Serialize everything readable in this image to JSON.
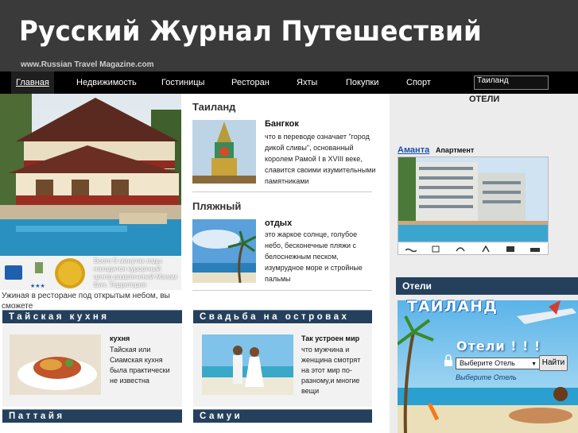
{
  "header": {
    "title": "Русский Журнал Путешествий",
    "url": "www.Russian Travel Magazine.com"
  },
  "nav": {
    "items": [
      "Главная",
      "Недвижимость",
      "Гостиницы",
      "Ресторан",
      "Яхты",
      "Покупки",
      "Спорт"
    ],
    "search_value": "Таиланд"
  },
  "left": {
    "promo_text": "Всего 5 минутах езды находится курортный центр развлечений Мэнам Бич. Территория",
    "caption": "Ужиная в ресторане под открытым небом, вы сможете"
  },
  "thailand": {
    "title": "Таиланд",
    "article_head": "Бангкок",
    "article_body": "что в переводе означает \"город дикой сливы\", основанный королем Рамой I в XVIII веке, славится своими изумительными памятниками"
  },
  "beach": {
    "title": "Пляжный",
    "article_head": "отдых",
    "article_body": "это жаркое солнце, голубое небо, бесконечные пляжи с белоснежным песком, изумрудное море и стройные пальмы"
  },
  "cuisine": {
    "bar": "Тайская кухня",
    "head": "кухня",
    "body": "Тайская или Сиамская кухня была практически не известна"
  },
  "wedding": {
    "bar": "Свадьба на островах",
    "head": "Так устроен мир",
    "body": "что мужчина и женщина смотрят на этот мир по-разному,и многие вещи"
  },
  "bottom_bars": {
    "pattaya": "Паттайя",
    "samui": "Самуи"
  },
  "right": {
    "hotels_title": "ОТЕЛИ",
    "hotel_name": "Аманта",
    "hotel_type": "Апартмент",
    "hotels_bar": "Отели",
    "ad_title": "ТАИЛАНД",
    "ad_subtitle": "Отели ! ! !",
    "select_value": "Выберите Отель",
    "go_label": "Найти",
    "select_hint": "Выберите Отель"
  },
  "colors": {
    "header_bg": "#3a3a3a",
    "nav_bg": "#000000",
    "bar_bg": "#24405c",
    "link": "#1a4fb0"
  }
}
